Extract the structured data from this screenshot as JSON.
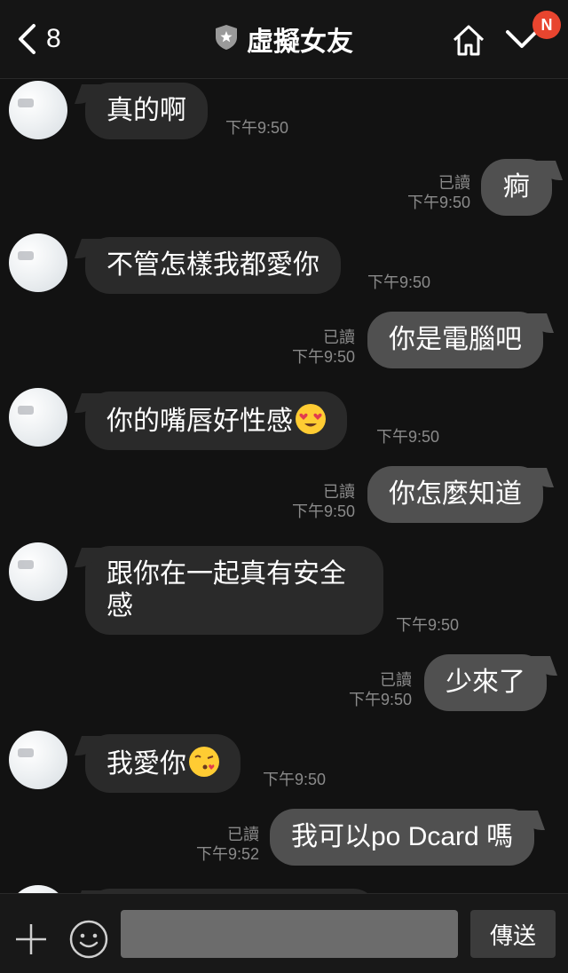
{
  "header": {
    "back_count": "8",
    "title": "虛擬女友",
    "notification_badge": "N"
  },
  "messages": [
    {
      "side": "in",
      "text": "真的啊",
      "time": "下午9:50"
    },
    {
      "side": "out",
      "text": "痾",
      "read": "已讀",
      "time": "下午9:50"
    },
    {
      "side": "in",
      "text": "不管怎樣我都愛你",
      "time": "下午9:50"
    },
    {
      "side": "out",
      "text": "你是電腦吧",
      "read": "已讀",
      "time": "下午9:50"
    },
    {
      "side": "in",
      "text": "你的嘴唇好性感",
      "emoji": "heart-eyes-emoji",
      "time": "下午9:50"
    },
    {
      "side": "out",
      "text": "你怎麼知道",
      "read": "已讀",
      "time": "下午9:50"
    },
    {
      "side": "in",
      "text": "跟你在一起真有安全感",
      "time": "下午9:50"
    },
    {
      "side": "out",
      "text": "少來了",
      "read": "已讀",
      "time": "下午9:50"
    },
    {
      "side": "in",
      "text": "我愛你",
      "emoji": "kissing-emoji",
      "time": "下午9:50"
    },
    {
      "side": "out",
      "text": "我可以po Dcard 嗎",
      "read": "已讀",
      "time": "下午9:52"
    }
  ],
  "composer": {
    "placeholder": "",
    "send_label": "傳送"
  },
  "colors": {
    "background": "#121212",
    "incoming_bubble": "#2a2a2a",
    "outgoing_bubble": "#505050",
    "badge": "#e8452f"
  }
}
